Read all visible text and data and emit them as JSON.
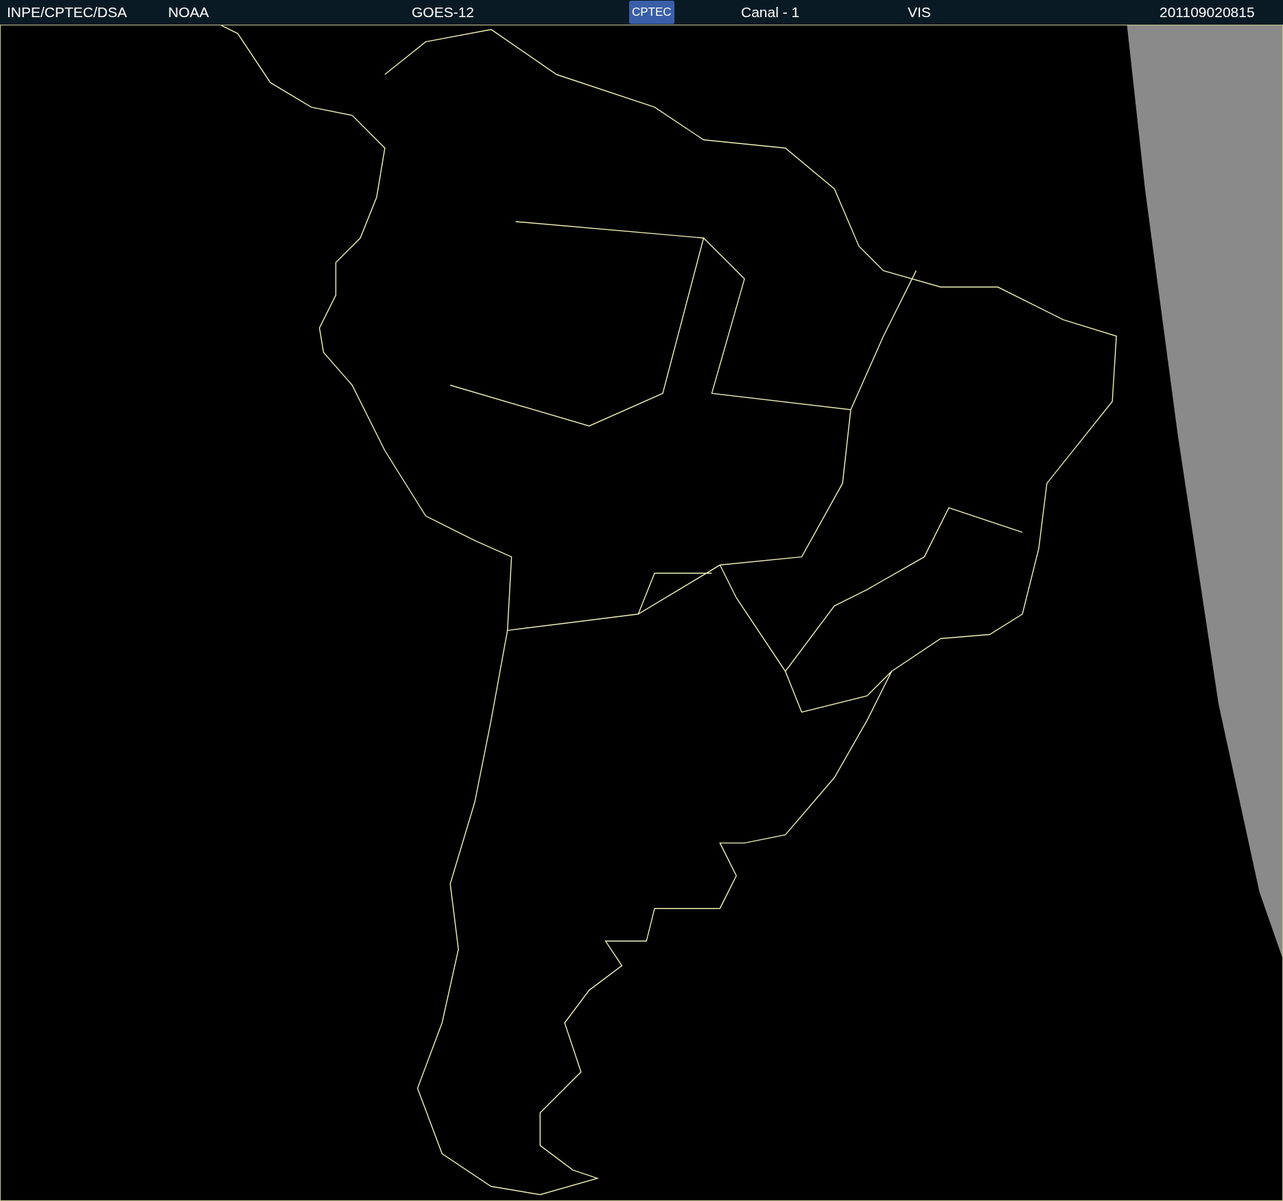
{
  "header": {
    "items": [
      {
        "kind": "text",
        "text": "INPE/CPTEC/DSA"
      },
      {
        "kind": "text",
        "text": "NOAA"
      },
      {
        "kind": "text",
        "text": "GOES-12"
      },
      {
        "kind": "logo",
        "text": "CPTEC"
      },
      {
        "kind": "text",
        "text": "Canal - 1"
      },
      {
        "kind": "text",
        "text": "VIS"
      },
      {
        "kind": "text",
        "text": "201109020815"
      }
    ]
  }
}
